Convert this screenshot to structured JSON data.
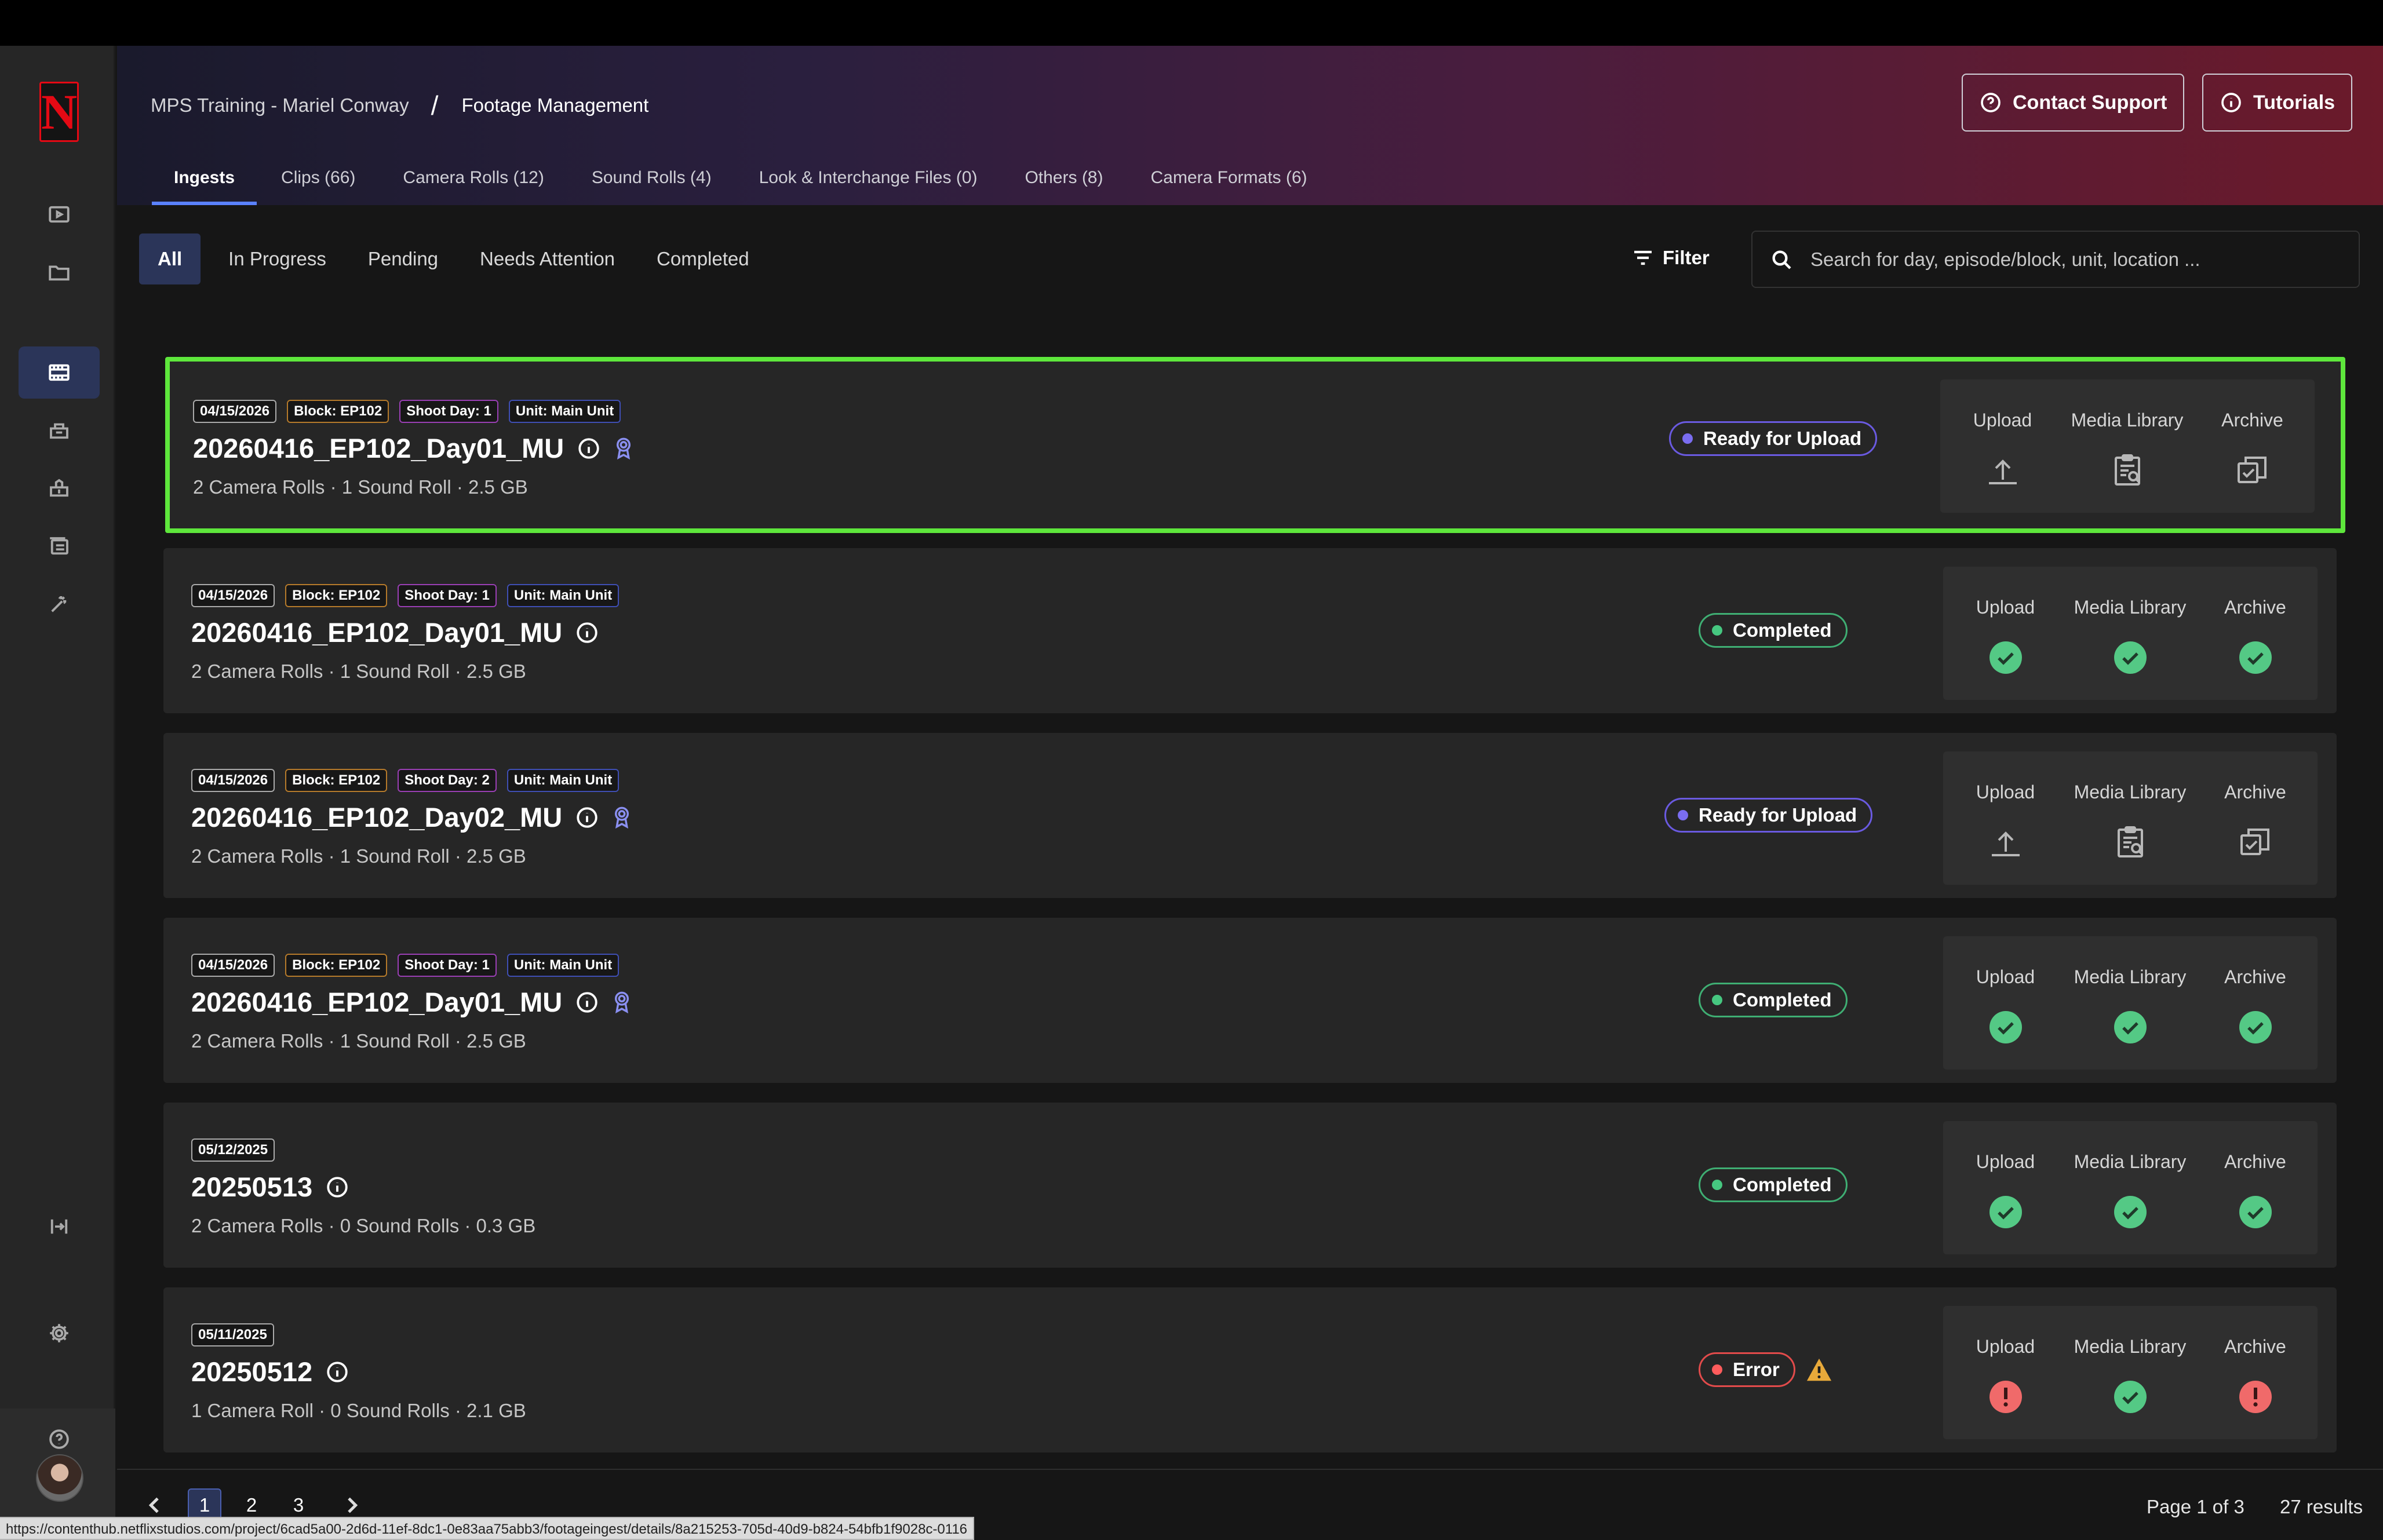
{
  "breadcrumb": {
    "project": "MPS Training - Mariel Conway",
    "separator": "/",
    "page": "Footage Management"
  },
  "header_buttons": {
    "contact_support": "Contact Support",
    "tutorials": "Tutorials"
  },
  "tabs": [
    {
      "label": "Ingests",
      "active": true
    },
    {
      "label": "Clips (66)"
    },
    {
      "label": "Camera Rolls (12)"
    },
    {
      "label": "Sound Rolls (4)"
    },
    {
      "label": "Look & Interchange Files (0)"
    },
    {
      "label": "Others (8)"
    },
    {
      "label": "Camera Formats (6)"
    }
  ],
  "subtabs": [
    {
      "label": "All",
      "active": true
    },
    {
      "label": "In Progress"
    },
    {
      "label": "Pending"
    },
    {
      "label": "Needs Attention"
    },
    {
      "label": "Completed"
    }
  ],
  "filter_label": "Filter",
  "search": {
    "placeholder": "Search for day, episode/block, unit, location ..."
  },
  "action_labels": {
    "upload": "Upload",
    "media_library": "Media Library",
    "archive": "Archive"
  },
  "ingests": [
    {
      "date": "04/15/2026",
      "block": "Block: EP102",
      "shoot_day": "Shoot Day: 1",
      "unit": "Unit: Main Unit",
      "title": "20260416_EP102_Day01_MU",
      "details": "2 Camera Rolls · 1 Sound Roll · 2.5 GB",
      "status": "Ready for Upload",
      "selected": true
    },
    {
      "date": "04/15/2026",
      "block": "Block: EP102",
      "shoot_day": "Shoot Day: 1",
      "unit": "Unit: Main Unit",
      "title": "20260416_EP102_Day01_MU",
      "details": "2 Camera Rolls · 1 Sound Roll · 2.5 GB",
      "status": "Completed"
    },
    {
      "date": "04/15/2026",
      "block": "Block: EP102",
      "shoot_day": "Shoot Day: 2",
      "unit": "Unit: Main Unit",
      "title": "20260416_EP102_Day02_MU",
      "details": "2 Camera Rolls · 1 Sound Roll · 2.5 GB",
      "status": "Ready for Upload"
    },
    {
      "date": "04/15/2026",
      "block": "Block: EP102",
      "shoot_day": "Shoot Day: 1",
      "unit": "Unit: Main Unit",
      "title": "20260416_EP102_Day01_MU",
      "details": "2 Camera Rolls · 1 Sound Roll · 2.5 GB",
      "status": "Completed"
    },
    {
      "date": "05/12/2025",
      "title": "20250513",
      "details": "2 Camera Rolls · 0 Sound Rolls · 0.3 GB",
      "status": "Completed"
    },
    {
      "date": "05/11/2025",
      "title": "20250512",
      "details": "1 Camera Roll · 0 Sound Rolls · 2.1 GB",
      "status": "Error"
    }
  ],
  "pagination": {
    "pages": [
      "1",
      "2",
      "3"
    ],
    "current": "1",
    "page_info": "Page 1 of 3",
    "results": "27 results"
  },
  "status_url": "https://contenthub.netflixstudios.com/project/6cad5a00-2d6d-11ef-8dc1-0e83aa75abb3/footageingest/details/8a215253-705d-40d9-b824-54bfb1f9028c-0116",
  "colors": {
    "accent": "#5a82ff",
    "selected_outline": "#5ee73c",
    "success": "#46c780",
    "error": "#ff5c5c",
    "ready": "#7a6df0",
    "warning": "#e8a93a"
  },
  "icons": {
    "sidebar": [
      "play-icon",
      "folder-icon",
      "film-icon",
      "inbox-icon",
      "download-icon",
      "list-icon",
      "magic-wand-icon",
      "collapse-icon",
      "gear-icon",
      "help-icon"
    ]
  }
}
